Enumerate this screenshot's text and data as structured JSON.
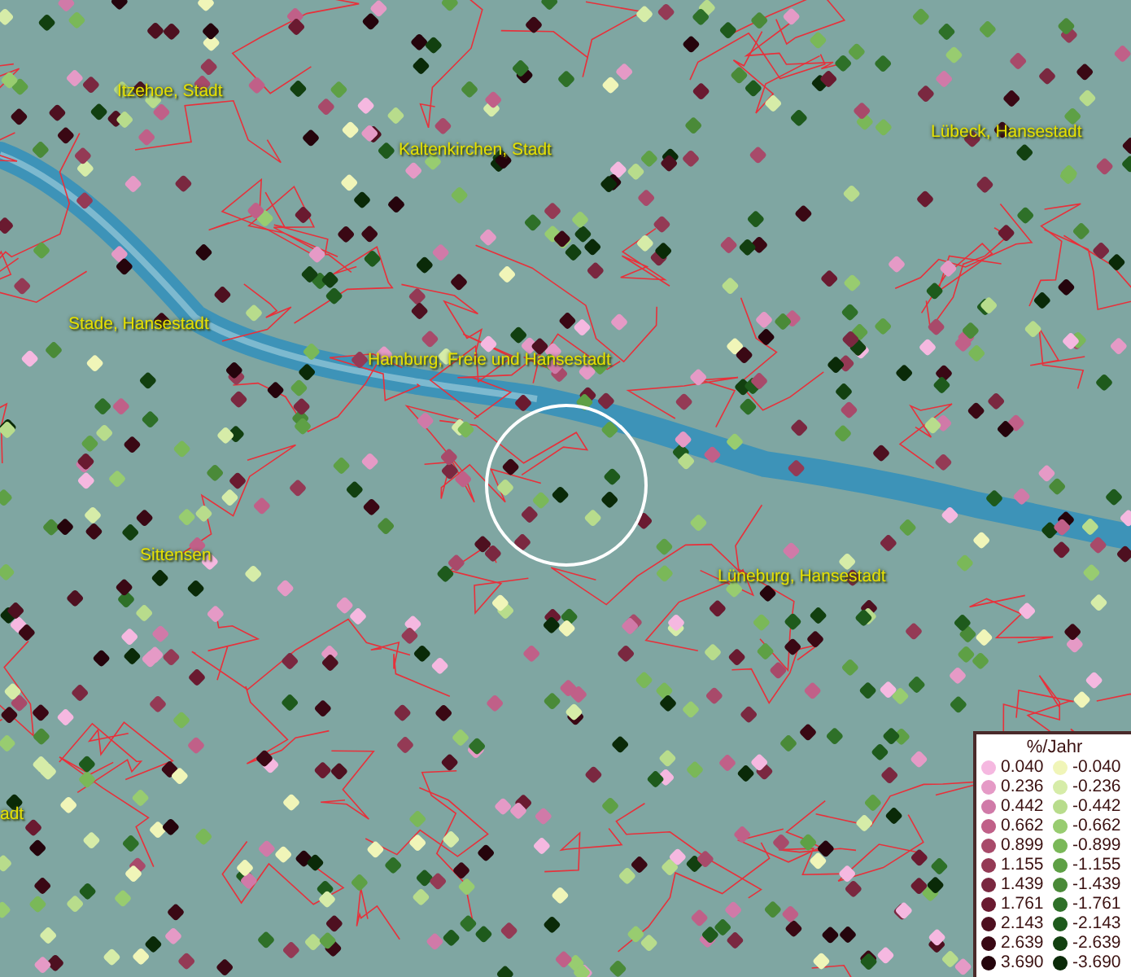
{
  "map": {
    "places": [
      {
        "name": "Itzehoe, Stadt"
      },
      {
        "name": "Kaltenkirchen, Stadt"
      },
      {
        "name": "Lübeck, Hansestadt"
      },
      {
        "name": "Stade, Hansestadt"
      },
      {
        "name": "Hamburg, Freie und Hansestadt"
      },
      {
        "name": "Sittensen"
      },
      {
        "name": "Lüneburg, Hansestadt"
      },
      {
        "name": "adt"
      }
    ]
  },
  "legend": {
    "title": "%/Jahr",
    "rows": [
      [
        {
          "label": "0.040",
          "color": "#f5b8e0"
        },
        {
          "label": "-0.040",
          "color": "#f0f5b8"
        }
      ],
      [
        {
          "label": "0.236",
          "color": "#e59ac6"
        },
        {
          "label": "-0.236",
          "color": "#d6eca8"
        }
      ],
      [
        {
          "label": "0.442",
          "color": "#d07aa8"
        },
        {
          "label": "-0.442",
          "color": "#b8dc8c"
        }
      ],
      [
        {
          "label": "0.662",
          "color": "#c06088"
        },
        {
          "label": "-0.662",
          "color": "#98cc70"
        }
      ],
      [
        {
          "label": "0.899",
          "color": "#a84a6a"
        },
        {
          "label": "-0.899",
          "color": "#7ab858"
        }
      ],
      [
        {
          "label": "1.155",
          "color": "#943a55"
        },
        {
          "label": "-1.155",
          "color": "#5ea045"
        }
      ],
      [
        {
          "label": "1.439",
          "color": "#7a2840"
        },
        {
          "label": "-1.439",
          "color": "#4a8a38"
        }
      ],
      [
        {
          "label": "1.761",
          "color": "#6a1a30"
        },
        {
          "label": "-1.761",
          "color": "#2e7028"
        }
      ],
      [
        {
          "label": "2.143",
          "color": "#4e1020"
        },
        {
          "label": "-2.143",
          "color": "#1e5a1c"
        }
      ],
      [
        {
          "label": "2.639",
          "color": "#3a0814"
        },
        {
          "label": "-2.639",
          "color": "#124010"
        }
      ],
      [
        {
          "label": "3.690",
          "color": "#25040c"
        },
        {
          "label": "-3.690",
          "color": "#0a2a08"
        }
      ]
    ]
  }
}
